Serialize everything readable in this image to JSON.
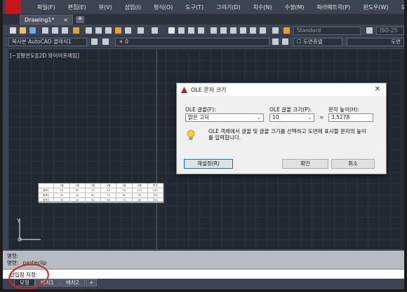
{
  "menu": [
    "파일(F)",
    "편집(E)",
    "뷰(V)",
    "삽입(I)",
    "형식(O)",
    "도구(T)",
    "그리기(D)",
    "치수(N)",
    "수정(M)",
    "파라메트릭(P)",
    "윈도우(W)",
    "도움말(H)"
  ],
  "doc_tab": {
    "title": "Drawing1*",
    "close": "×",
    "add": "+"
  },
  "toolbar": {
    "text_style": "Standard",
    "dim_style": "ISO-25",
    "named_view": "복사본 AutoCAD 클래식1",
    "layer_value": "0",
    "color_combo": "도면층별",
    "linetype_combo": "도면"
  },
  "viewport_label": "[−][평면도][2D 와이어프레임]",
  "table": {
    "header": [
      "",
      "1월",
      "2월",
      "3월",
      "4월",
      "5월",
      "6월",
      "합계"
    ],
    "rows": [
      [
        "항목1",
        "50",
        "60",
        "70",
        "80",
        "90",
        "100",
        "450"
      ],
      [
        "항목2",
        "40",
        "50",
        "60",
        "70",
        "80",
        "90",
        "390"
      ],
      [
        "항목3",
        "30",
        "40",
        "50",
        "60",
        "70",
        "80",
        "330"
      ]
    ]
  },
  "dialog": {
    "title": "OLE 문자 크기",
    "close": "✕",
    "font_label": "OLE 글꼴(F):",
    "font_value": "맑은 고딕",
    "size_label": "OLE 글꼴 크기(P):",
    "size_value": "10",
    "equals": "=",
    "height_label": "문자 높이(H):",
    "height_value": "3.5278",
    "info": "OLE 객체에서 글꼴 및 글꼴 크기를 선택하고 도면에 표시할 문자의 높이를 입력합니다.",
    "reset_label": "재설정(R)",
    "ok_label": "확인",
    "cancel_label": "취소"
  },
  "command": {
    "line1": "명령:",
    "line2": "명령:  _pasteclip",
    "input_text": "삽입점 지정:"
  },
  "layout_tabs": [
    "모형",
    "배치1",
    "배치2",
    "+"
  ],
  "colors": {
    "accent_red": "#e01e1e",
    "brand_red": "#c8161e",
    "canvas": "#212830"
  }
}
